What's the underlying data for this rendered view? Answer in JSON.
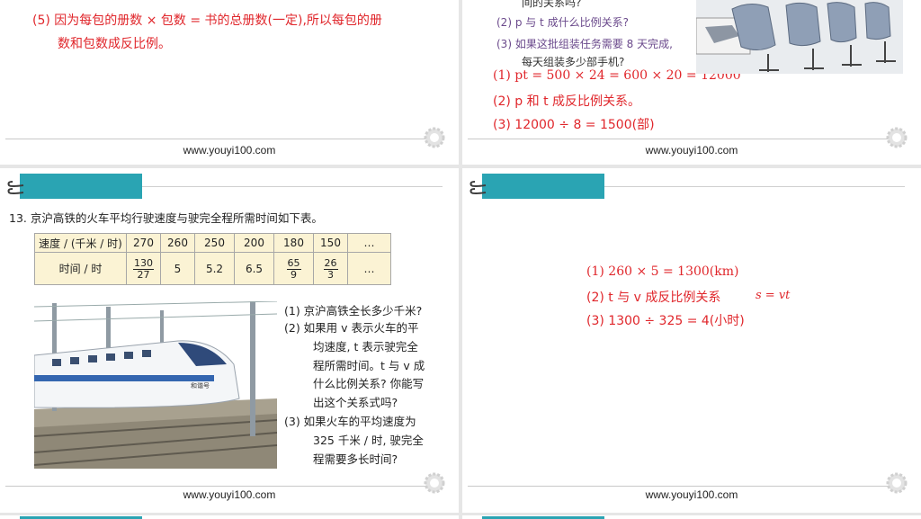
{
  "footer": {
    "url": "www.youyi100.com"
  },
  "panel1": {
    "line1": "(5) 因为每包的册数 × 包数 = 书的总册数(一定),所以每包的册",
    "line2": "数和包数成反比例。"
  },
  "panel2": {
    "clip_top": "间的关系吗?",
    "q2": "(2) p 与 t 成什么比例关系?",
    "q3_a": "(3) 如果这批组装任务需要 8 天完成,",
    "q3_b": "每天组装多少部手机?",
    "a1": "(1) pt = 500 × 24 = 600 × 20 = 12000",
    "a2": "(2) p 和 t 成反比例关系。",
    "a3": "(3) 12000 ÷ 8 = 1500(部)"
  },
  "panel3": {
    "title": "13. 京沪高铁的火车平均行驶速度与驶完全程所需时间如下表。",
    "table": {
      "row1_header": "速度 / (千米 / 时)",
      "row1": [
        "270",
        "260",
        "250",
        "200",
        "180",
        "150",
        "…"
      ],
      "row2_header": "时间 / 时",
      "row2": [
        {
          "num": "130",
          "den": "27"
        },
        {
          "text": "5"
        },
        {
          "text": "5.2"
        },
        {
          "text": "6.5"
        },
        {
          "num": "65",
          "den": "9"
        },
        {
          "num": "26",
          "den": "3"
        },
        {
          "text": "…"
        }
      ]
    },
    "train_label": "和谐号",
    "q1": "(1) 京沪高铁全长多少千米?",
    "q2_lines": [
      "(2) 如果用 v 表示火车的平",
      "均速度, t 表示驶完全",
      "程所需时间。t 与 v 成",
      "什么比例关系? 你能写",
      "出这个关系式吗?"
    ],
    "q3_lines": [
      "(3) 如果火车的平均速度为",
      "325 千米 / 时, 驶完全",
      "程需要多长时间?"
    ]
  },
  "panel4": {
    "a1": "(1) 260 × 5 = 1300(km)",
    "a2": "(2) t 与 v 成反比例关系",
    "a2_formula": "s = vt",
    "a3": "(3) 1300 ÷ 325 = 4(小时)"
  },
  "colors": {
    "accent_tab": "#2aa4b3",
    "answer_red": "#e0262b",
    "question_purple": "#6b4a8c",
    "table_fill": "#fbf3d4"
  }
}
